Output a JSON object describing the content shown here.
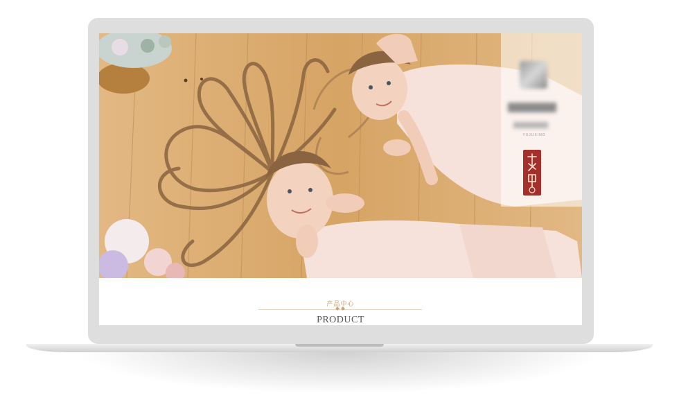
{
  "brand": {
    "tagline": "YUJUXING"
  },
  "section": {
    "subtitle": "产品中心",
    "title": "PRODUCT"
  },
  "colors": {
    "accent": "#c9a47a",
    "seal_red": "#a3302a",
    "wood": "#d9a86a"
  }
}
